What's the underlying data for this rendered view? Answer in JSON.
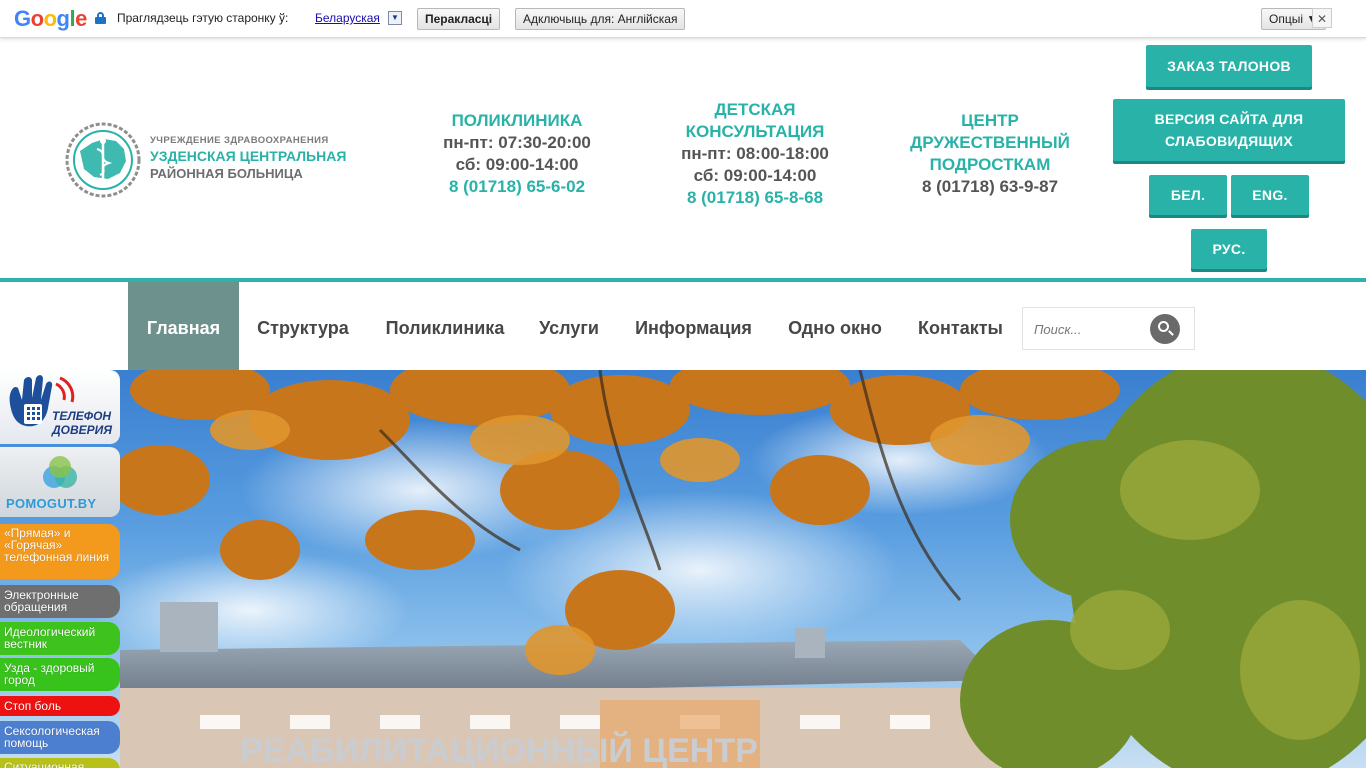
{
  "translate_bar": {
    "logo": "Google",
    "prompt": "Праглядзець гэтую старонку ў:",
    "language": "Беларуская",
    "translate_button": "Перакласці",
    "turn_off_button": "Адключыць для: Англійская",
    "options_button": "Опцыі ▼",
    "close": "✕"
  },
  "header": {
    "logo_line1": "УЧРЕЖДЕНИЕ ЗДРАВООХРАНЕНИЯ",
    "logo_line2": "УЗДЕНСКАЯ ЦЕНТРАЛЬНАЯ",
    "logo_line3": "РАЙОННАЯ БОЛЬНИЦА",
    "polyclinic": {
      "title": "ПОЛИКЛИНИКА",
      "hours1": "пн-пт: 07:30-20:00",
      "hours2": "сб: 09:00-14:00",
      "phone": "8 (01718) 65-6-02"
    },
    "children": {
      "title1": "ДЕТСКАЯ",
      "title2": "КОНСУЛЬТАЦИЯ",
      "hours1": "пн-пт: 08:00-18:00",
      "hours2": "сб: 09:00-14:00",
      "phone": "8 (01718) 65-8-68"
    },
    "teen": {
      "title1": "ЦЕНТР",
      "title2": "ДРУЖЕСТВЕННЫЙ",
      "title3": "ПОДРОСТКАМ",
      "phone": "8 (01718) 63-9-87"
    },
    "buttons": {
      "order": "ЗАКАЗ ТАЛОНОВ",
      "low_vision1": "ВЕРСИЯ САЙТА ДЛЯ",
      "low_vision2": "СЛАБОВИДЯЩИХ",
      "bel": "БЕЛ.",
      "eng": "ENG.",
      "rus": "РУС."
    }
  },
  "nav": {
    "items": [
      "Главная",
      "Структура",
      "Поликлиника",
      "Услуги",
      "Информация",
      "Одно окно",
      "Контакты"
    ],
    "search_placeholder": "Поиск..."
  },
  "hero": {
    "sign": "РЕАБИЛИТАЦИОННЫЙ ЦЕНТР"
  },
  "sidebar": {
    "trust_line1": "ТЕЛЕФОН",
    "trust_line2": "ДОВЕРИЯ",
    "pomogut": "POMOGUT.BY",
    "links": [
      "«Прямая» и «Горячая» телефонная линия",
      "Электронные обращения",
      "Идеологический вестник",
      "Узда - здоровый город",
      "Стоп боль",
      "Сексологическая помощь",
      "Ситуационная"
    ]
  },
  "colors": {
    "accent": "#29b2a8",
    "nav_active": "#6d918c",
    "text": "#555555"
  }
}
